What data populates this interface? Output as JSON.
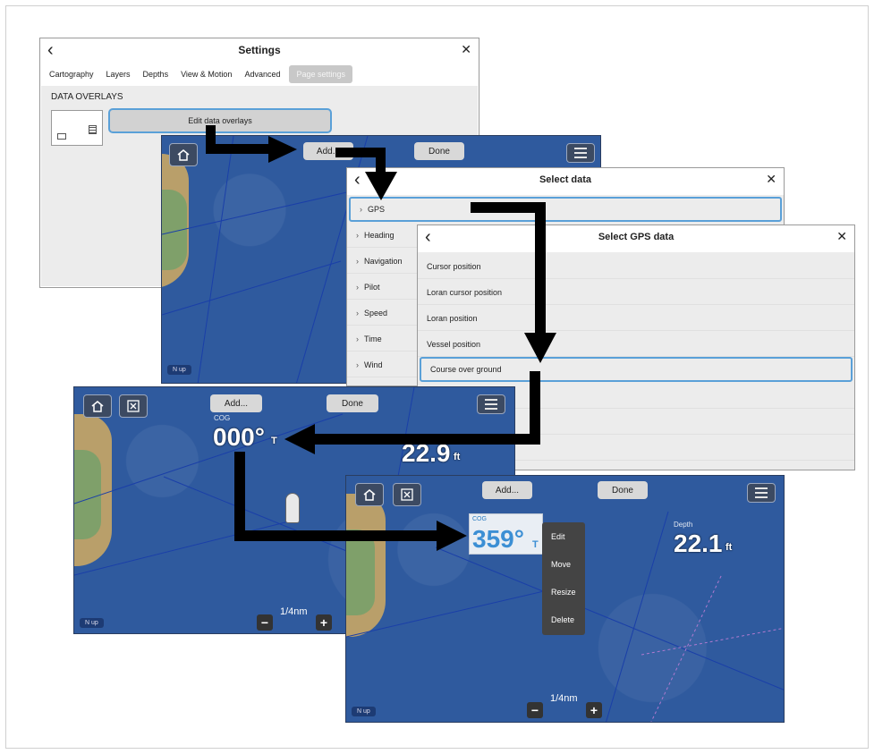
{
  "settings": {
    "back_glyph": "‹",
    "title": "Settings",
    "close_glyph": "✕",
    "tabs": [
      "Cartography",
      "Layers",
      "Depths",
      "View & Motion",
      "Advanced",
      "Page settings"
    ],
    "section_title": "DATA OVERLAYS",
    "edit_button": "Edit data overlays"
  },
  "chart_top": {
    "add_label": "Add...",
    "done_label": "Done",
    "north_label": "N up"
  },
  "select_data": {
    "back_glyph": "‹",
    "title": "Select data",
    "close_glyph": "✕",
    "items": [
      "GPS",
      "Heading",
      "Navigation",
      "Pilot",
      "Speed",
      "Time",
      "Wind"
    ]
  },
  "select_gps": {
    "back_glyph": "‹",
    "title": "Select GPS data",
    "close_glyph": "✕",
    "items": [
      "Cursor position",
      "Loran cursor position",
      "Loran position",
      "Vessel position",
      "Course over ground"
    ]
  },
  "chart_left": {
    "add_label": "Add...",
    "done_label": "Done",
    "cog_label": "COG",
    "cog_value": "000°",
    "cog_unit": "T",
    "depth_value": "22.9",
    "depth_unit": "ft",
    "scale_label": "1/4nm",
    "north_label": "N up",
    "minus": "−",
    "plus": "+"
  },
  "chart_right": {
    "add_label": "Add...",
    "done_label": "Done",
    "cog_label": "COG",
    "cog_value": "359°",
    "cog_unit": "T",
    "depth_label": "Depth",
    "depth_value": "22.1",
    "depth_unit": "ft",
    "scale_label": "1/4nm",
    "north_label": "N up",
    "minus": "−",
    "plus": "+",
    "context_menu": [
      "Edit",
      "Move",
      "Resize",
      "Delete"
    ]
  },
  "colors": {
    "water": "#2f5a9e",
    "highlight": "#5aa0d8",
    "arrow": "#000000"
  }
}
